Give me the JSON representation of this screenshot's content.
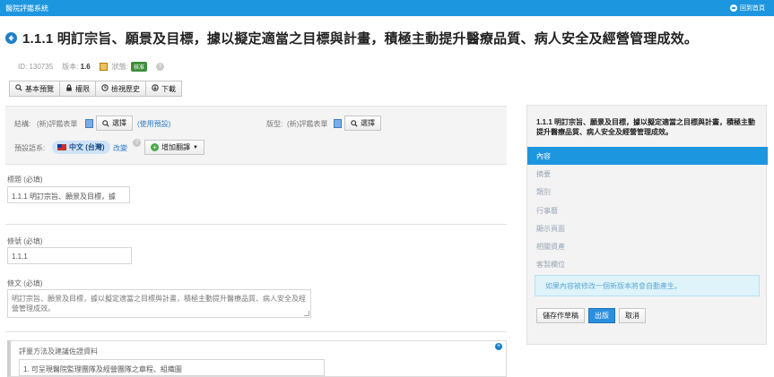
{
  "topbar": {
    "app_title": "醫院評鑑系統",
    "user_label": "回到首頁"
  },
  "header": {
    "title": "1.1.1 明訂宗旨、願景及目標，據以擬定適當之目標與計畫，積極主動提升醫療品質、病人安全及經營管理成效。"
  },
  "meta": {
    "id_label": "ID: 130735",
    "version_label": "版本:",
    "version_value": "1.6",
    "status_label": "狀態:",
    "status_badge": "核准"
  },
  "toolbar": {
    "basic_preview": "基本預覽",
    "permissions": "權限",
    "view_history": "檢視歷史",
    "download": "下載"
  },
  "structure": {
    "structure_label": "結構:",
    "structure_value": "(新)評鑑表單",
    "select_label": "選擇",
    "use_default": "(使用預設)",
    "layout_label": "版型:",
    "layout_value": "(新)評鑑表單",
    "layout_select": "選擇",
    "default_lang_label": "預設語系:",
    "lang_value": "中文 (台灣)",
    "change_link": "改變",
    "add_translation": "增加翻譯"
  },
  "form": {
    "title_label": "標題 (必填)",
    "title_value": "1.1.1 明訂宗旨、願景及目標，據",
    "clause_no_label": "條號 (必填)",
    "clause_no_value": "1.1.1",
    "clause_text_label": "條文 (必填)",
    "clause_text_value": "明訂宗旨、願景及目標，據以擬定適當之目標與計畫，積極主動提升醫療品質、病人安全及經營管理成效。",
    "eval_section_label": "評量方法及建議佐證資料",
    "eval_item_value": "1. 可呈現醫院監理團隊及經營團隊之章程、組織圖"
  },
  "sidebar": {
    "title": "1.1.1 明訂宗旨、願景及目標，據以擬定適當之目標與計畫，積極主動提升醫療品質、病人安全及經營管理成效。",
    "items": [
      "內容",
      "摘要",
      "類別",
      "行事曆",
      "顯示頁面",
      "相關資產",
      "客製欄位"
    ],
    "info_message": "如果內容被修改一個新版本將會自動產生。",
    "save_draft": "儲存作草稿",
    "publish": "出版",
    "cancel": "取消"
  }
}
